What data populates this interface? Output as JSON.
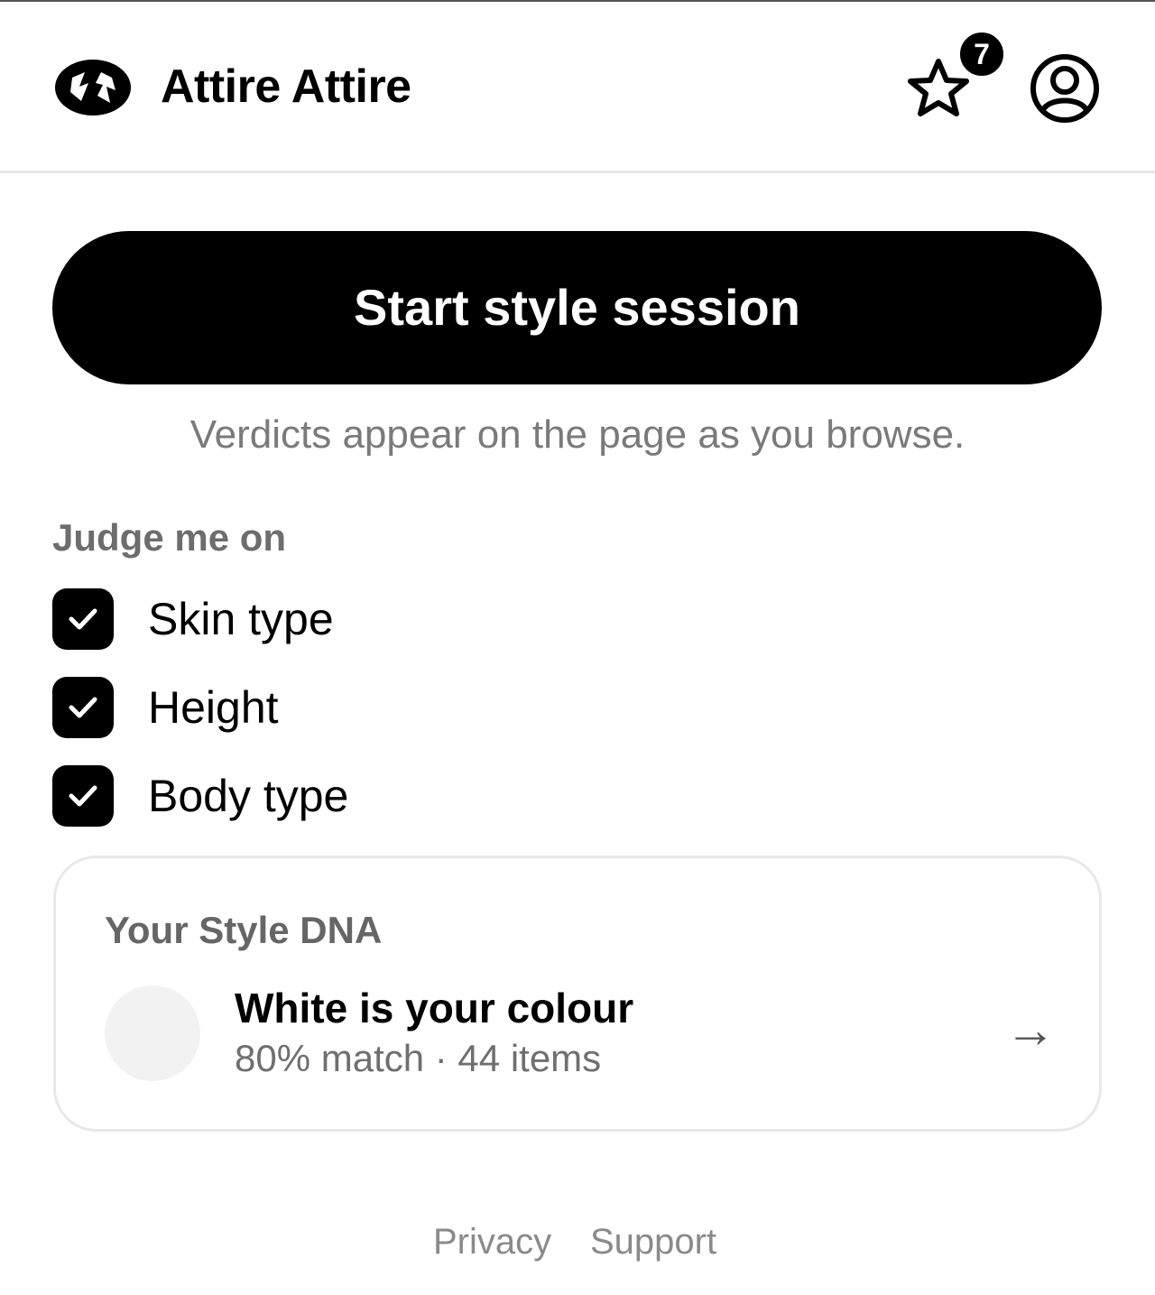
{
  "app": {
    "name": "Attire Attire",
    "logo_icon": "brand-logo-icon"
  },
  "header": {
    "favorites_icon": "star-icon",
    "favorites_count": "7",
    "account_icon": "user-circle-icon"
  },
  "session": {
    "start_label": "Start style session",
    "hint": "Verdicts appear on the page as you browse."
  },
  "criteria": {
    "label": "Judge me on",
    "items": [
      {
        "label": "Skin type",
        "checked": true
      },
      {
        "label": "Height",
        "checked": true
      },
      {
        "label": "Body type",
        "checked": true
      }
    ]
  },
  "style_dna": {
    "title": "Your Style DNA",
    "headline": "White is your colour",
    "meta": "80% match · 44 items",
    "swatch_color": "#f2f2f2",
    "arrow": "→"
  },
  "footer": {
    "privacy": "Privacy",
    "support": "Support"
  },
  "colors": {
    "accent": "#000000",
    "muted": "#7a7a7a",
    "border": "#e6e6e6"
  }
}
